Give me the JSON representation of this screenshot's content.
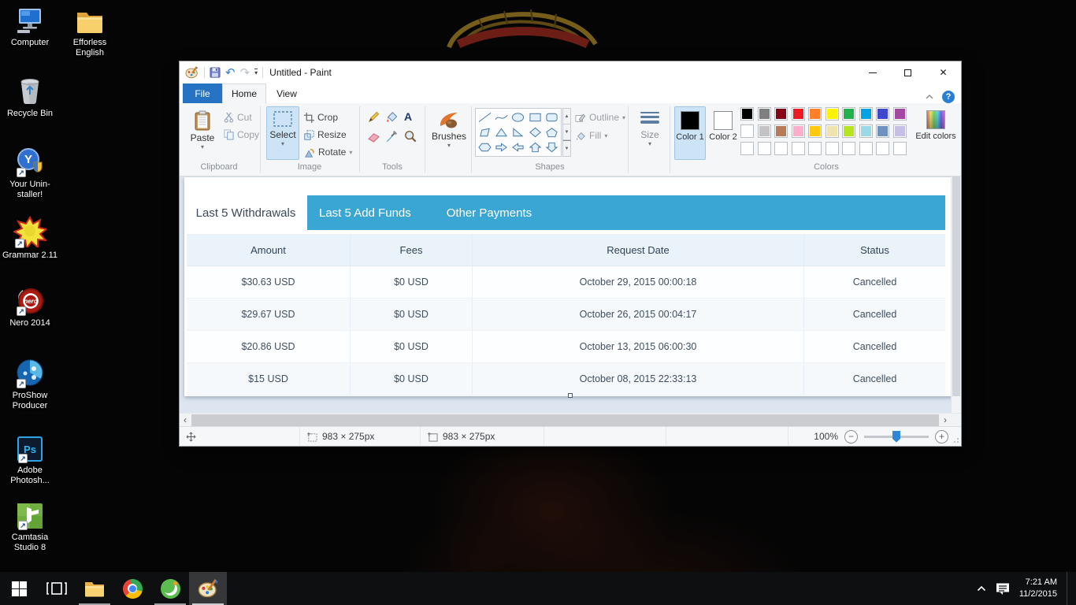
{
  "desktop": {
    "icons": [
      {
        "label": "Computer"
      },
      {
        "label": "Efforless English"
      },
      {
        "label": "Recycle Bin"
      },
      {
        "label": "Your Unin-staller!"
      },
      {
        "label": "Grammar 2.11"
      },
      {
        "label": "Nero 2014"
      },
      {
        "label": "ProShow Producer"
      },
      {
        "label": "Adobe Photosh..."
      },
      {
        "label": "Camtasia Studio 8"
      }
    ]
  },
  "paint": {
    "window_title": "Untitled - Paint",
    "menu_tabs": {
      "file": "File",
      "home": "Home",
      "view": "View"
    },
    "ribbon": {
      "paste": "Paste",
      "cut": "Cut",
      "copy": "Copy",
      "clipboard_group": "Clipboard",
      "select": "Select",
      "crop": "Crop",
      "resize": "Resize",
      "rotate": "Rotate",
      "image_group": "Image",
      "tools_group": "Tools",
      "brushes": "Brushes",
      "shapes_group": "Shapes",
      "outline": "Outline",
      "fill": "Fill",
      "size": "Size",
      "color1": "Color 1",
      "color2": "Color 2",
      "edit_colors": "Edit colors",
      "colors_group": "Colors",
      "palette": {
        "row1": [
          "#000000",
          "#7f7f7f",
          "#880015",
          "#ed1c24",
          "#ff7f27",
          "#fff200",
          "#22b14c",
          "#00a2e8",
          "#3f48cc",
          "#a349a4"
        ],
        "row2": [
          "#ffffff",
          "#c3c3c3",
          "#b97a57",
          "#ffaec9",
          "#ffc90e",
          "#efe4b0",
          "#b5e61d",
          "#99d9ea",
          "#7092be",
          "#c8bfe7"
        ]
      }
    },
    "canvas_image": {
      "tabs": [
        "Last 5 Withdrawals",
        "Last 5 Add Funds",
        "Other Payments"
      ],
      "active_tab": "Last 5 Withdrawals",
      "accent_color": "#3aa6d4",
      "header_bg": "#eaf3fa",
      "table": {
        "columns": [
          "Amount",
          "Fees",
          "Request Date",
          "Status"
        ],
        "rows": [
          [
            "$30.63 USD",
            "$0 USD",
            "October 29, 2015 00:00:18",
            "Cancelled"
          ],
          [
            "$29.67 USD",
            "$0 USD",
            "October 26, 2015 00:04:17",
            "Cancelled"
          ],
          [
            "$20.86 USD",
            "$0 USD",
            "October 13, 2015 06:00:30",
            "Cancelled"
          ],
          [
            "$15 USD",
            "$0 USD",
            "October 08, 2015 22:33:13",
            "Cancelled"
          ]
        ]
      }
    },
    "status_bar": {
      "selection_size": "983 × 275px",
      "image_size": "983 × 275px",
      "zoom_level": "100%"
    }
  },
  "taskbar": {
    "time": "7:21 AM",
    "date": "11/2/2015"
  },
  "glyphs": {
    "dropdown": "▾",
    "undo": "↶",
    "redo": "↷",
    "close": "✕",
    "help": "?",
    "scroll_left": "‹",
    "scroll_right": "›",
    "gallery_up": "▲",
    "gallery_down": "▼",
    "zoom_minus": "−",
    "zoom_plus": "+",
    "shortcut_arrow": "↗",
    "text_tool": "A"
  }
}
